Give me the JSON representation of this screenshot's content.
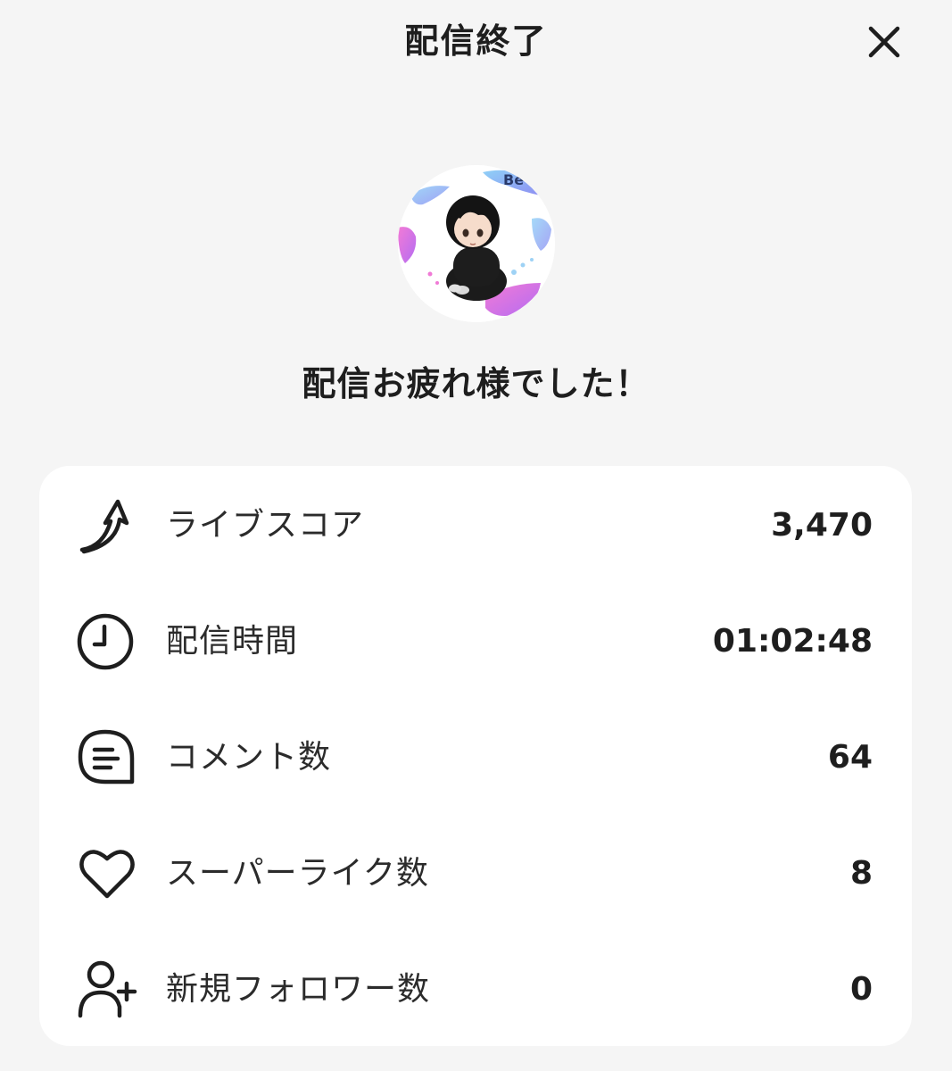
{
  "header": {
    "title": "配信終了"
  },
  "main": {
    "greeting": "配信お疲れ様でした！"
  },
  "stats": [
    {
      "label": "ライブスコア",
      "value": "3,470",
      "icon": "score-arrow-icon"
    },
    {
      "label": "配信時間",
      "value": "01:02:48",
      "icon": "clock-icon"
    },
    {
      "label": "コメント数",
      "value": "64",
      "icon": "comment-icon"
    },
    {
      "label": "スーパーライク数",
      "value": "8",
      "icon": "heart-icon"
    },
    {
      "label": "新規フォロワー数",
      "value": "0",
      "icon": "add-user-icon"
    }
  ],
  "colors": {
    "background": "#f5f5f5",
    "card": "#ffffff",
    "text": "#1e1e1e",
    "avatar_accent_pink": "#e86ad3",
    "avatar_accent_blue": "#7ab8f0"
  }
}
